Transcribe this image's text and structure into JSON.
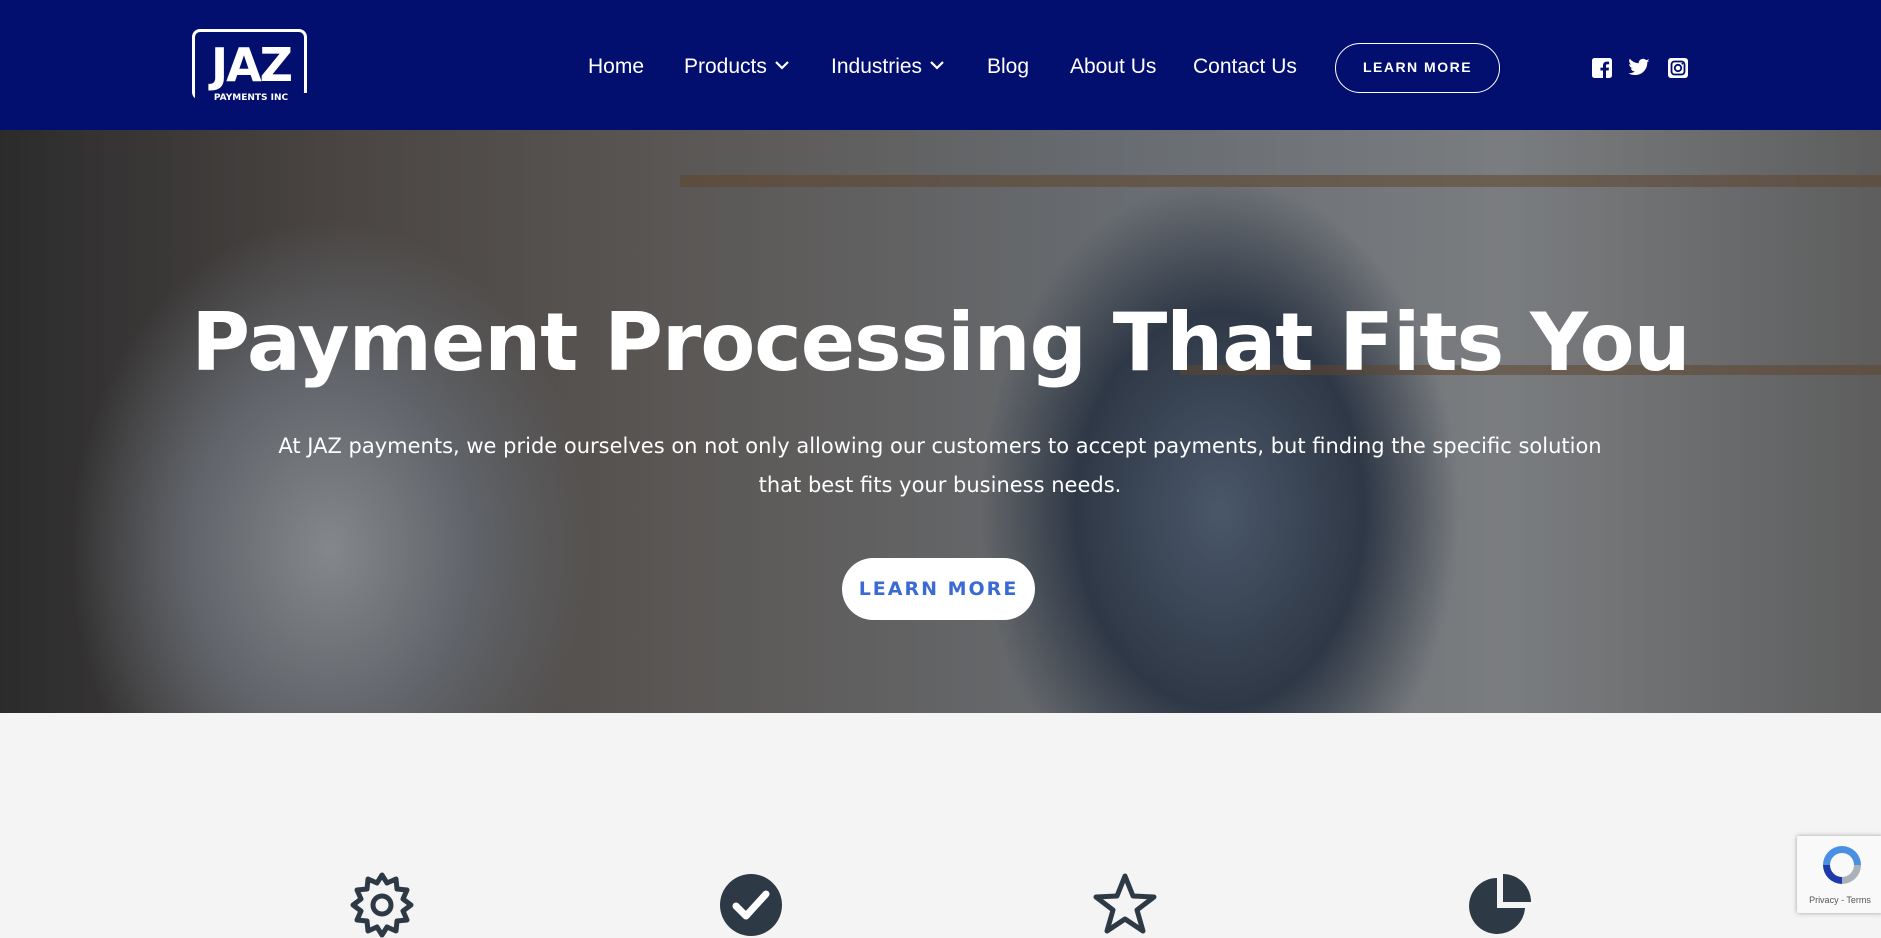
{
  "brand": {
    "logo_mark": "JAZ",
    "logo_sub": "PAYMENTS INC",
    "header_bg": "#030f6e"
  },
  "nav": {
    "items": [
      {
        "label": "Home",
        "has_dropdown": false
      },
      {
        "label": "Products",
        "has_dropdown": true
      },
      {
        "label": "Industries",
        "has_dropdown": true
      },
      {
        "label": "Blog",
        "has_dropdown": false
      },
      {
        "label": "About Us",
        "has_dropdown": false
      },
      {
        "label": "Contact Us",
        "has_dropdown": false
      }
    ],
    "cta_label": "LEARN MORE"
  },
  "social": {
    "icons": [
      "facebook-icon",
      "twitter-icon",
      "instagram-icon"
    ]
  },
  "hero": {
    "title": "Payment Processing That Fits You",
    "text": "At JAZ payments, we pride ourselves on not only allowing our customers to accept payments, but finding the specific solution that best fits your business needs.",
    "cta_label": "LEARN MORE",
    "cta_color": "#3b6ad3"
  },
  "features": {
    "icons": [
      "gear-icon",
      "check-circle-icon",
      "star-icon",
      "pie-chart-icon"
    ],
    "icon_color": "#2d3a46"
  },
  "recaptcha": {
    "privacy": "Privacy",
    "separator": " - ",
    "terms": "Terms"
  }
}
